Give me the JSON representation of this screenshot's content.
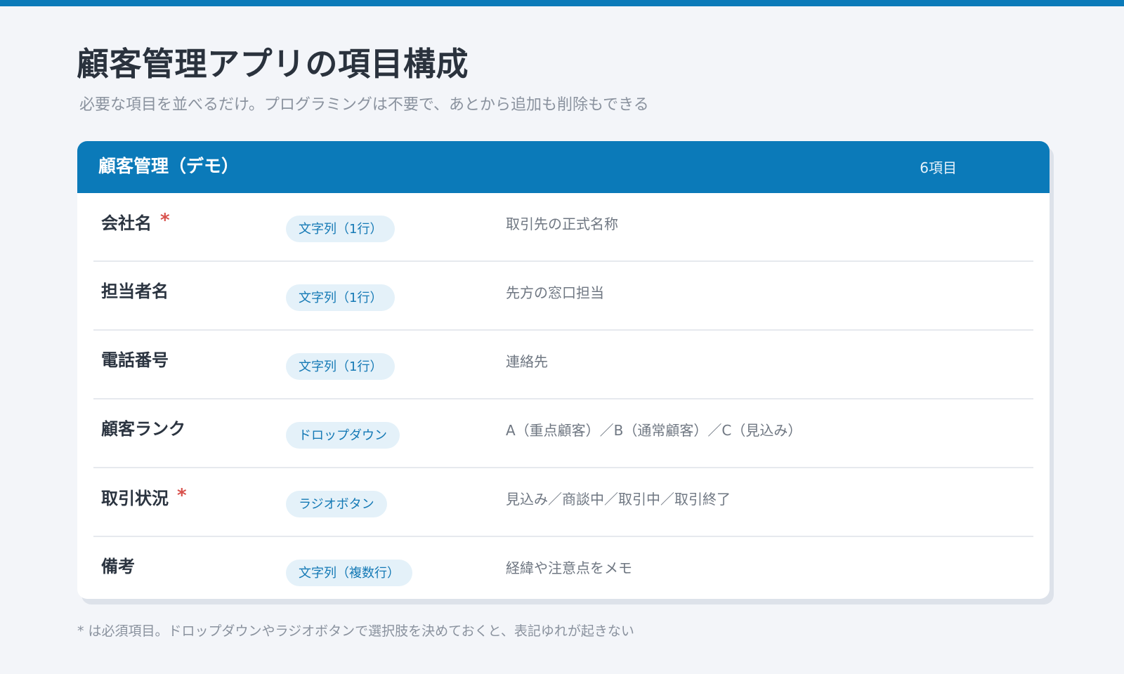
{
  "page": {
    "title": "顧客管理アプリの項目構成",
    "subtitle": "必要な項目を並べるだけ。プログラミングは不要で、あとから追加も削除もできる"
  },
  "card": {
    "title": "顧客管理（デモ）",
    "count": "6項目"
  },
  "required_mark": "*",
  "fields": [
    {
      "name": "会社名",
      "required": true,
      "type": "文字列（1行）",
      "description": "取引先の正式名称"
    },
    {
      "name": "担当者名",
      "required": false,
      "type": "文字列（1行）",
      "description": "先方の窓口担当"
    },
    {
      "name": "電話番号",
      "required": false,
      "type": "文字列（1行）",
      "description": "連絡先"
    },
    {
      "name": "顧客ランク",
      "required": false,
      "type": "ドロップダウン",
      "description": "A（重点顧客）／B（通常顧客）／C（見込み）"
    },
    {
      "name": "取引状況",
      "required": true,
      "type": "ラジオボタン",
      "description": "見込み／商談中／取引中／取引終了"
    },
    {
      "name": "備考",
      "required": false,
      "type": "文字列（複数行）",
      "description": "経緯や注意点をメモ"
    }
  ],
  "footnote": "* は必須項目。ドロップダウンやラジオボタンで選択肢を決めておくと、表記ゆれが起きない",
  "colors": {
    "accent": "#0b7ab9",
    "required": "#d8524d",
    "pill_bg": "#e4f1f9",
    "pill_text": "#1479b5",
    "background": "#f3f5f9"
  }
}
